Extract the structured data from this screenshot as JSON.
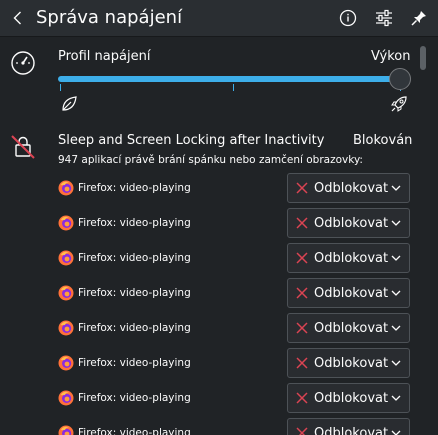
{
  "header": {
    "title": "Správa napájení",
    "icons": {
      "back": "chevron-left-icon",
      "info": "info-icon",
      "configure": "configure-icon",
      "pin": "pin-icon"
    }
  },
  "power_profile": {
    "label": "Profil napájení",
    "value": "Výkon",
    "levels": [
      "power-save",
      "balanced",
      "performance"
    ],
    "selected_level": "performance",
    "icons": {
      "section": "speedometer-icon",
      "low": "leaf-icon",
      "high": "rocket-icon"
    },
    "accent": "#3daee9"
  },
  "inhibition": {
    "title": "Sleep and Screen Locking after Inactivity",
    "status": "Blokován",
    "summary": "947 aplikací právě brání spánku nebo zamčení obrazovky:",
    "icon": "lock-blocked-icon",
    "items": [
      {
        "app": "Firefox: video-playing",
        "action": "Odblokovat"
      },
      {
        "app": "Firefox: video-playing",
        "action": "Odblokovat"
      },
      {
        "app": "Firefox: video-playing",
        "action": "Odblokovat"
      },
      {
        "app": "Firefox: video-playing",
        "action": "Odblokovat"
      },
      {
        "app": "Firefox: video-playing",
        "action": "Odblokovat"
      },
      {
        "app": "Firefox: video-playing",
        "action": "Odblokovat"
      },
      {
        "app": "Firefox: video-playing",
        "action": "Odblokovat"
      },
      {
        "app": "Firefox: video-playing",
        "action": "Odblokovat"
      }
    ]
  },
  "colors": {
    "background": "#202326",
    "header": "#2a2e32",
    "accent": "#3daee9",
    "danger": "#da4453"
  }
}
